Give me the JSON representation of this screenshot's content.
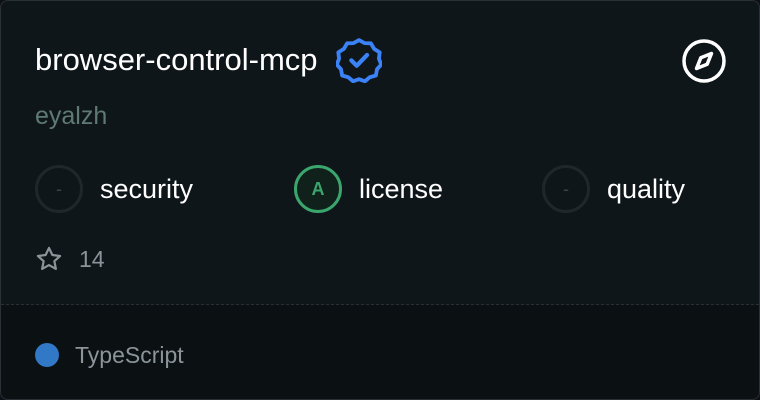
{
  "repo": {
    "name": "browser-control-mcp",
    "author": "eyalzh",
    "verified": true
  },
  "icons": {
    "verified": "verified-badge-icon",
    "explore": "compass-icon",
    "star": "star-icon"
  },
  "metrics": [
    {
      "label": "security",
      "grade": "-"
    },
    {
      "label": "license",
      "grade": "A"
    },
    {
      "label": "quality",
      "grade": "-"
    }
  ],
  "stars": "14",
  "language": {
    "name": "TypeScript",
    "color": "#3178c6"
  },
  "colors": {
    "background": "#0f1619",
    "verified_badge": "#3b82f6",
    "grade_a": "#3ba56e",
    "muted_text": "#8b949a",
    "author_text": "#5f7a73"
  }
}
